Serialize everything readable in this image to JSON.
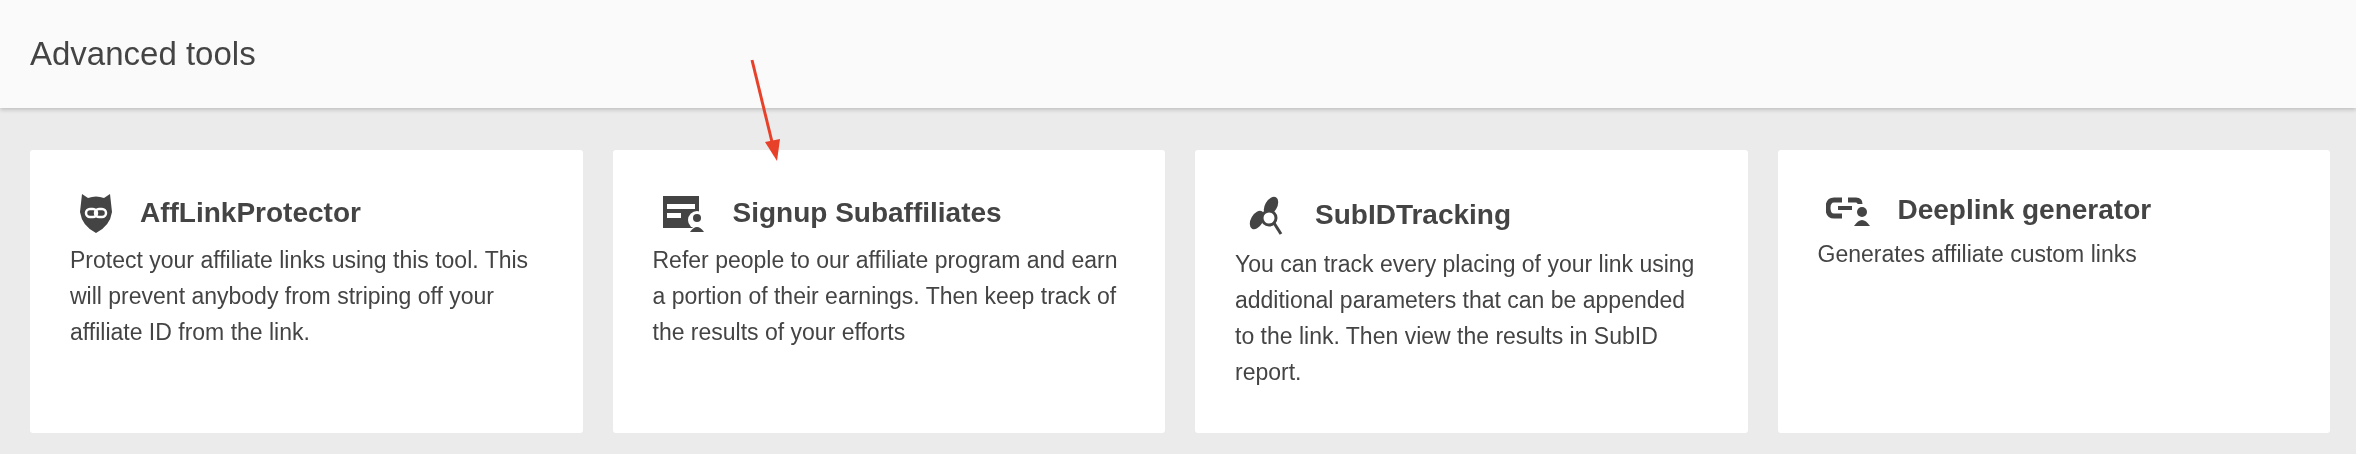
{
  "header": {
    "title": "Advanced tools"
  },
  "tools": [
    {
      "title": "AffLinkProtector",
      "description": "Protect your affiliate links using this tool. This will prevent anybody from striping off your affiliate ID from the link."
    },
    {
      "title": "Signup Subaffiliates",
      "description": "Refer people to our affiliate program and earn a portion of their earnings. Then keep track of the results of your efforts"
    },
    {
      "title": "SubIDTracking",
      "description": "You can track every placing of your link using additional parameters that can be appended to the link. Then view the results in SubID report."
    },
    {
      "title": "Deeplink generator",
      "description": "Generates affiliate custom links"
    }
  ]
}
